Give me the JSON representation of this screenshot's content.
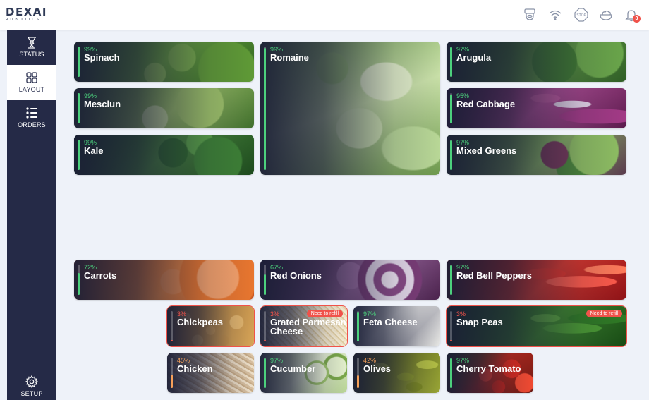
{
  "brand": {
    "logo": "DEXAI",
    "logo_sub": "ROBOTICS"
  },
  "topbar": {
    "icons": [
      "bowl-dispenser-icon",
      "wifi-icon",
      "stop-icon",
      "salad-bowl-icon",
      "bell-icon"
    ],
    "notifications_count": "3"
  },
  "sidebar": {
    "items": [
      {
        "label": "STATUS",
        "icon": "robot-arm-icon",
        "active": false
      },
      {
        "label": "LAYOUT",
        "icon": "layout-grid-icon",
        "active": true
      },
      {
        "label": "ORDERS",
        "icon": "list-icon",
        "active": false
      }
    ],
    "setup": {
      "label": "SETUP",
      "icon": "gear-icon"
    }
  },
  "status_colors": {
    "good": "#4cd07d",
    "medium": "#f5a05a",
    "low": "#f0524a"
  },
  "ingredients": [
    {
      "percent": "99%",
      "name": "Spinach",
      "level": 0.99,
      "status": "good"
    },
    {
      "percent": "99%",
      "name": "Romaine",
      "level": 0.99,
      "status": "good"
    },
    {
      "percent": "97%",
      "name": "Arugula",
      "level": 0.97,
      "status": "good"
    },
    {
      "percent": "99%",
      "name": "Mesclun",
      "level": 0.99,
      "status": "good"
    },
    {
      "percent": "95%",
      "name": "Red Cabbage",
      "level": 0.95,
      "status": "good"
    },
    {
      "percent": "99%",
      "name": "Kale",
      "level": 0.99,
      "status": "good"
    },
    {
      "percent": "97%",
      "name": "Mixed Greens",
      "level": 0.97,
      "status": "good"
    },
    {
      "percent": "72%",
      "name": "Carrots",
      "level": 0.72,
      "status": "good"
    },
    {
      "percent": "67%",
      "name": "Red Onions",
      "level": 0.67,
      "status": "good"
    },
    {
      "percent": "97%",
      "name": "Red Bell Peppers",
      "level": 0.97,
      "status": "good"
    },
    {
      "percent": "3%",
      "name": "Chickpeas",
      "level": 0.03,
      "status": "low"
    },
    {
      "percent": "3%",
      "name": "Grated Parmesan Cheese",
      "level": 0.03,
      "status": "low",
      "alert": "Need to refill"
    },
    {
      "percent": "97%",
      "name": "Feta Cheese",
      "level": 0.97,
      "status": "good"
    },
    {
      "percent": "3%",
      "name": "Snap Peas",
      "level": 0.03,
      "status": "low",
      "alert": "Need to refill"
    },
    {
      "percent": "45%",
      "name": "Chicken",
      "level": 0.45,
      "status": "medium"
    },
    {
      "percent": "97%",
      "name": "Cucumber",
      "level": 0.97,
      "status": "good"
    },
    {
      "percent": "42%",
      "name": "Olives",
      "level": 0.42,
      "status": "medium"
    },
    {
      "percent": "97%",
      "name": "Cherry Tomato",
      "level": 0.97,
      "status": "good"
    }
  ]
}
